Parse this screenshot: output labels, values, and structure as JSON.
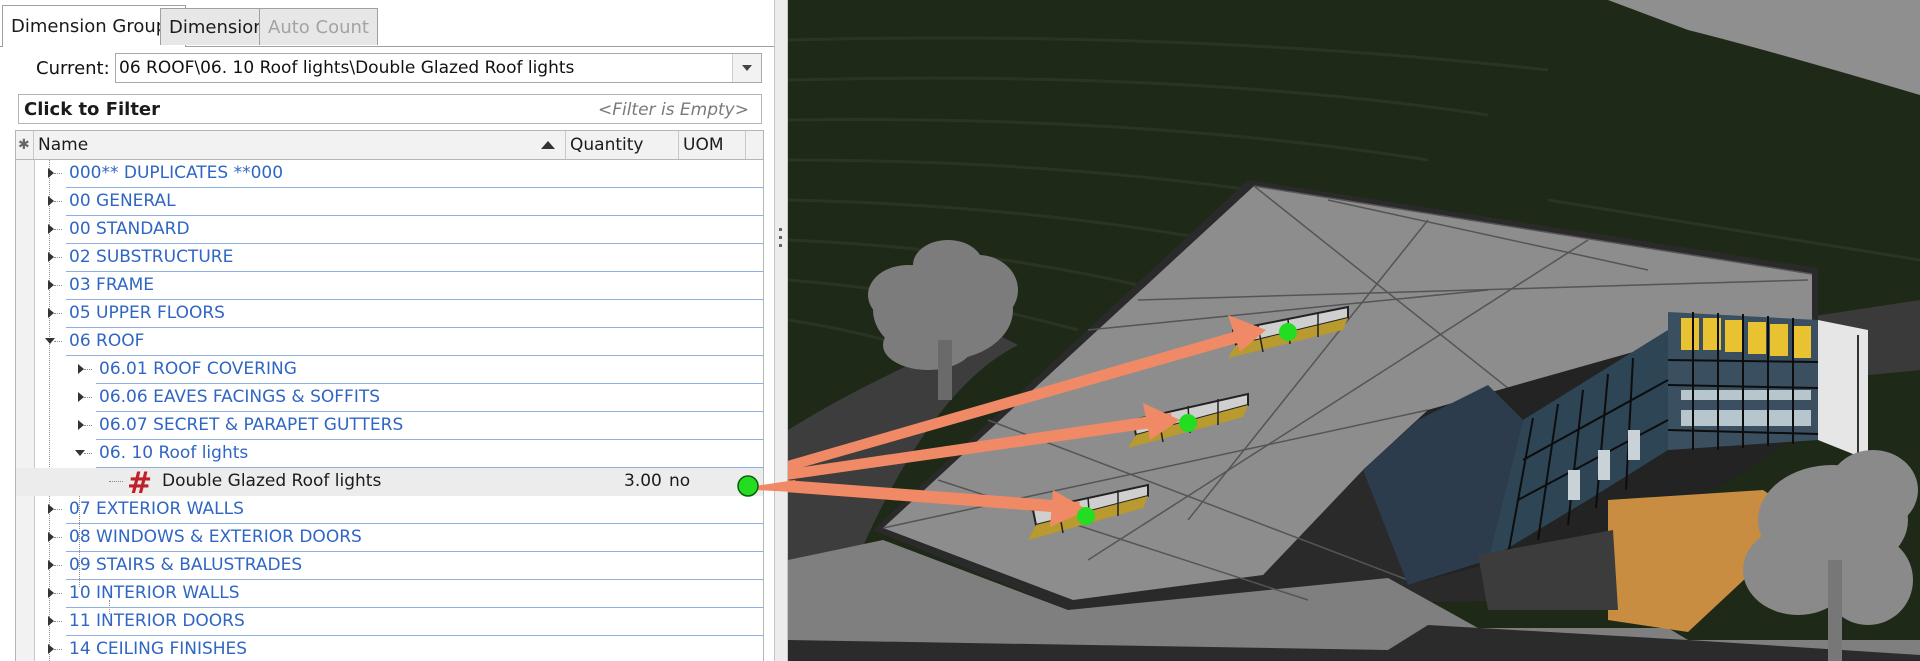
{
  "tabs": [
    {
      "label": "Dimension Groups",
      "state": "active"
    },
    {
      "label": "Dimensions",
      "state": "normal"
    },
    {
      "label": "Auto Count",
      "state": "disabled"
    }
  ],
  "current": {
    "label": "Current:",
    "value": "06 ROOF\\06. 10 Roof lights\\Double Glazed Roof lights"
  },
  "filter": {
    "label": "Click to Filter",
    "status": "<Filter is Empty>"
  },
  "grid": {
    "columns": {
      "indicator": "✱",
      "name": "Name",
      "quantity": "Quantity",
      "uom": "UOM"
    },
    "rows": [
      {
        "label": "000** DUPLICATES **000"
      },
      {
        "label": "00 GENERAL"
      },
      {
        "label": "00 STANDARD"
      },
      {
        "label": "02 SUBSTRUCTURE"
      },
      {
        "label": "03 FRAME"
      },
      {
        "label": "05 UPPER FLOORS"
      },
      {
        "label": "06 ROOF"
      },
      {
        "label": "06.01 ROOF COVERING"
      },
      {
        "label": "06.06 EAVES FACINGS & SOFFITS"
      },
      {
        "label": "06.07 SECRET & PARAPET GUTTERS"
      },
      {
        "label": "06. 10 Roof lights"
      },
      {
        "label": "Double Glazed Roof lights",
        "quantity": "3.00",
        "uom": "no"
      },
      {
        "label": "07 EXTERIOR WALLS"
      },
      {
        "label": "08 WINDOWS & EXTERIOR DOORS"
      },
      {
        "label": "09 STAIRS & BALUSTRADES"
      },
      {
        "label": "10 INTERIOR WALLS"
      },
      {
        "label": "11 INTERIOR DOORS"
      },
      {
        "label": "14 CEILING FINISHES"
      }
    ]
  },
  "icons": {
    "item": "hash-count-icon",
    "marker": "green-count-marker-icon"
  },
  "colors": {
    "link_text": "#2f66c4",
    "count_marker": "#22dd22",
    "arrow": "#f08a66",
    "hash": "#c0202a"
  }
}
